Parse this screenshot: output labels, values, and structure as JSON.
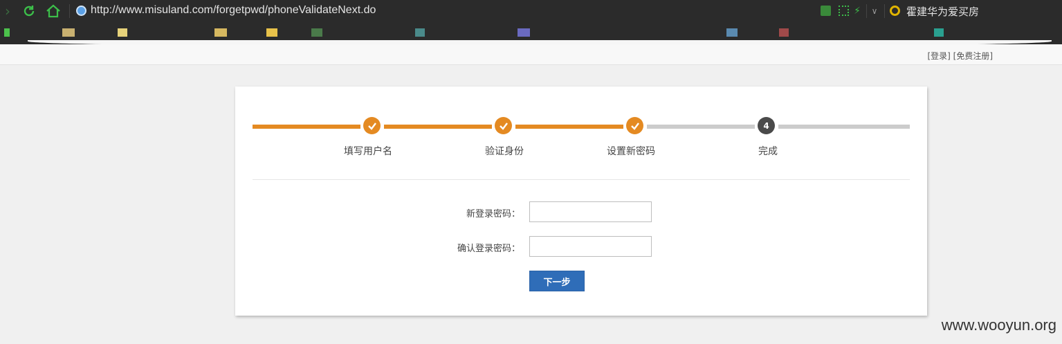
{
  "browser": {
    "url": "http://www.misuland.com/forgetpwd/phoneValidateNext.do",
    "search_text": "霍建华为爱买房"
  },
  "header": {
    "links": "[登录] [免费注册]"
  },
  "steps": [
    {
      "label": "填写用户名",
      "status": "done"
    },
    {
      "label": "验证身份",
      "status": "done"
    },
    {
      "label": "设置新密码",
      "status": "done"
    },
    {
      "label": "完成",
      "status": "current",
      "number": "4"
    }
  ],
  "form": {
    "new_password_label": "新登录密码：",
    "confirm_password_label": "确认登录密码：",
    "next_button": "下一步"
  },
  "watermark": "www.wooyun.org",
  "colors": {
    "accent": "#e48a22",
    "inactive": "#cccccc",
    "button": "#2f6db8"
  }
}
